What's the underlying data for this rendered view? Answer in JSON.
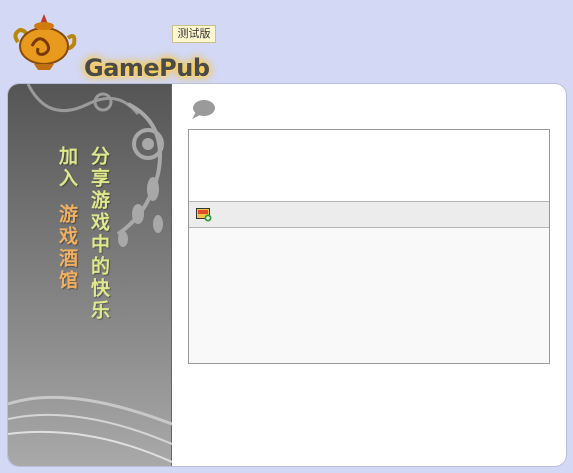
{
  "header": {
    "logo_text": "GamePub",
    "beta_badge": "测试版"
  },
  "sidebar": {
    "slogan_line1": "分享游戏中的快乐",
    "slogan_line2_a": "加入",
    "slogan_line2_b": "游戏酒馆"
  },
  "composer": {
    "comment_icon": "speech-bubble-icon",
    "image_button_icon": "add-image-icon",
    "input_value": ""
  },
  "colors": {
    "page_background": "#d3d8f5",
    "slogan_green": "#dfe88a",
    "slogan_orange": "#f0b060",
    "logo_glow": "#ffb300"
  }
}
